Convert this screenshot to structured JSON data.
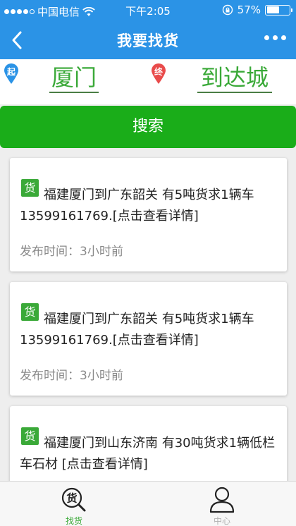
{
  "status_bar": {
    "carrier": "中国电信",
    "time": "下午2:05",
    "battery": "57%",
    "battery_level": 0.57
  },
  "header": {
    "title": "我要找货"
  },
  "route": {
    "from_marker": "起",
    "from_city": "厦门",
    "to_marker": "终",
    "to_city": "到达城"
  },
  "search": {
    "label": "搜索"
  },
  "listings": [
    {
      "tag": "货",
      "text": "福建厦门到广东韶关 有5吨货求1辆车 13599161769.[点击查看详情]",
      "time_label": "发布时间：",
      "time_value": "3小时前"
    },
    {
      "tag": "货",
      "text": "福建厦门到广东韶关 有5吨货求1辆车 13599161769.[点击查看详情]",
      "time_label": "发布时间：",
      "time_value": "3小时前"
    },
    {
      "tag": "货",
      "text": "福建厦门到山东济南 有30吨货求1辆低栏车石材 [点击查看详情]",
      "time_label": "",
      "time_value": ""
    }
  ],
  "tabbar": {
    "tabs": [
      {
        "label": "找货",
        "icon": "goods-search-icon",
        "active": true
      },
      {
        "label": "中心",
        "icon": "person-icon",
        "active": false
      }
    ]
  },
  "colors": {
    "header": "#2b93e6",
    "accent_green": "#3aa938",
    "button_green": "#1aad19",
    "pin_blue": "#2b93e6",
    "pin_red": "#e94b4b"
  }
}
